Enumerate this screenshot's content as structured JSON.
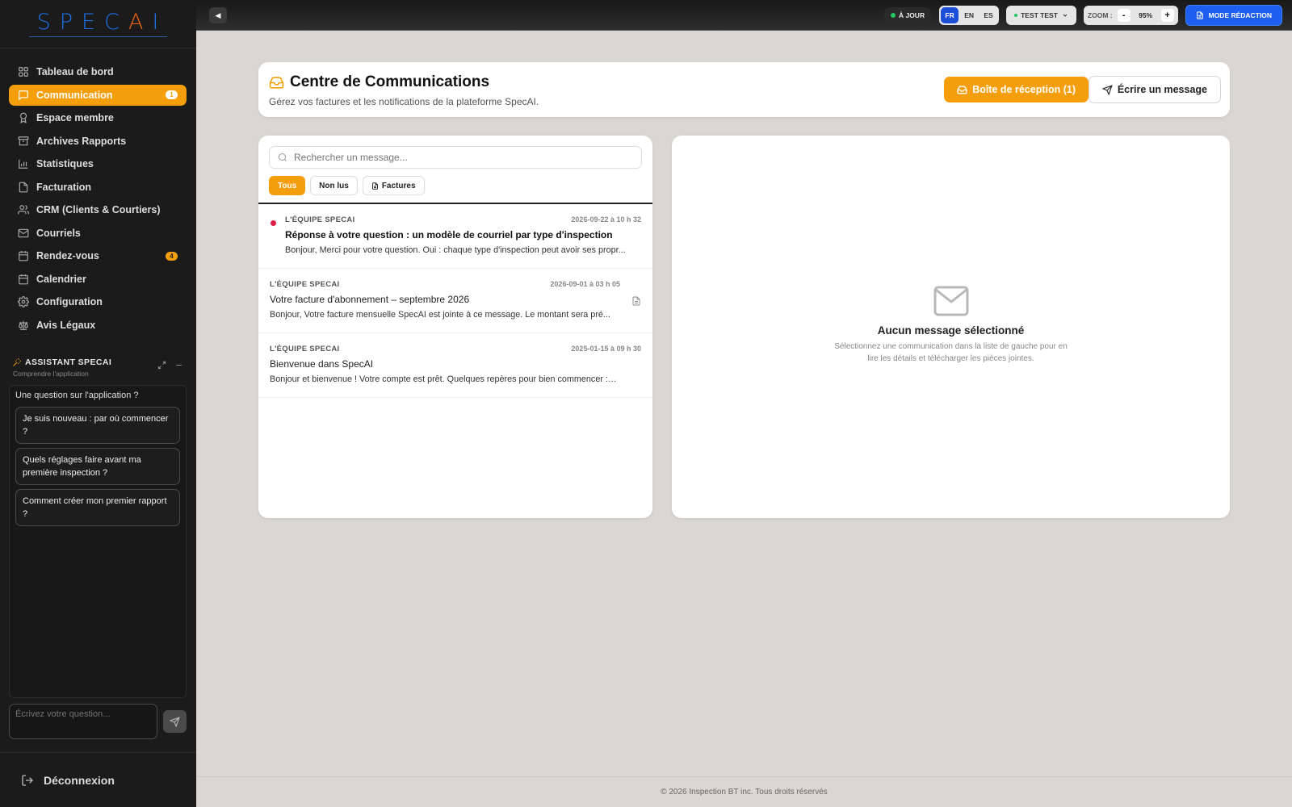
{
  "app": {
    "logo": "SPECAI"
  },
  "sidebar": {
    "items": [
      {
        "label": "Tableau de bord",
        "icon": "dashboard-icon"
      },
      {
        "label": "Communication",
        "icon": "chat-icon",
        "badge": "1",
        "active": true
      },
      {
        "label": "Espace membre",
        "icon": "award-icon"
      },
      {
        "label": "Archives Rapports",
        "icon": "archive-icon"
      },
      {
        "label": "Statistiques",
        "icon": "bar-chart-icon"
      },
      {
        "label": "Facturation",
        "icon": "billing-icon"
      },
      {
        "label": "CRM (Clients & Courtiers)",
        "icon": "users-icon"
      },
      {
        "label": "Courriels",
        "icon": "mail-icon"
      },
      {
        "label": "Rendez-vous",
        "icon": "calendar-icon",
        "badge": "4"
      },
      {
        "label": "Calendrier",
        "icon": "calendar-icon"
      },
      {
        "label": "Configuration",
        "icon": "gear-icon"
      },
      {
        "label": "Avis Légaux",
        "icon": "scale-icon"
      }
    ],
    "assistant": {
      "title": "ASSISTANT SPECAI",
      "subtitle": "Comprendre l'application",
      "question": "Une question sur l'application ?",
      "suggestions": [
        "Je suis nouveau : par où commencer ?",
        "Quels réglages faire avant ma première inspection ?",
        "Comment créer mon premier rapport ?"
      ],
      "input_placeholder": "Écrivez votre question..."
    },
    "logout_label": "Déconnexion"
  },
  "topbar": {
    "status": "À JOUR",
    "languages": [
      "FR",
      "EN",
      "ES"
    ],
    "active_language": "FR",
    "user": "TEST TEST",
    "zoom_label": "ZOOM :",
    "zoom_value": "95%",
    "zoom_minus": "-",
    "zoom_plus": "+",
    "mode_button": "MODE RÉDACTION"
  },
  "header": {
    "title": "Centre de Communications",
    "subtitle": "Gérez vos factures et les notifications de la plateforme SpecAI.",
    "inbox_button": "Boîte de réception (1)",
    "write_button": "Écrire un message"
  },
  "messages_panel": {
    "search_placeholder": "Rechercher un message...",
    "filters": [
      "Tous",
      "Non lus",
      "Factures"
    ],
    "active_filter": "Tous",
    "messages": [
      {
        "from": "L'ÉQUIPE SPECAI",
        "date": "2026-09-22 à 10 h 32",
        "subject": "Réponse à votre question : un modèle de courriel par type d'inspection",
        "preview": "Bonjour, Merci pour votre question. Oui : chaque type d'inspection peut avoir ses propr...",
        "unread": true,
        "attachment": false
      },
      {
        "from": "L'ÉQUIPE SPECAI",
        "date": "2026-09-01 à 03 h 05",
        "subject": "Votre facture d'abonnement – septembre 2026",
        "preview": "Bonjour, Votre facture mensuelle SpecAI est jointe à ce message. Le montant sera pré...",
        "unread": false,
        "attachment": true
      },
      {
        "from": "L'ÉQUIPE SPECAI",
        "date": "2025-01-15 à 09 h 30",
        "subject": "Bienvenue dans SpecAI",
        "preview": "Bonjour et bienvenue ! Votre compte est prêt. Quelques repères pour bien commencer : • ...",
        "unread": false,
        "attachment": false
      }
    ]
  },
  "detail_panel": {
    "empty_title": "Aucun message sélectionné",
    "empty_description": "Sélectionnez une communication dans la liste de gauche pour en lire les détails et télécharger les pièces jointes."
  },
  "footer": {
    "text": "© 2026 Inspection BT inc. Tous droits réservés"
  },
  "colors": {
    "accent": "#f59e0b",
    "primary": "#1d5ef0",
    "unread": "#e11d48",
    "sidebar_bg": "#1b1b1b"
  }
}
